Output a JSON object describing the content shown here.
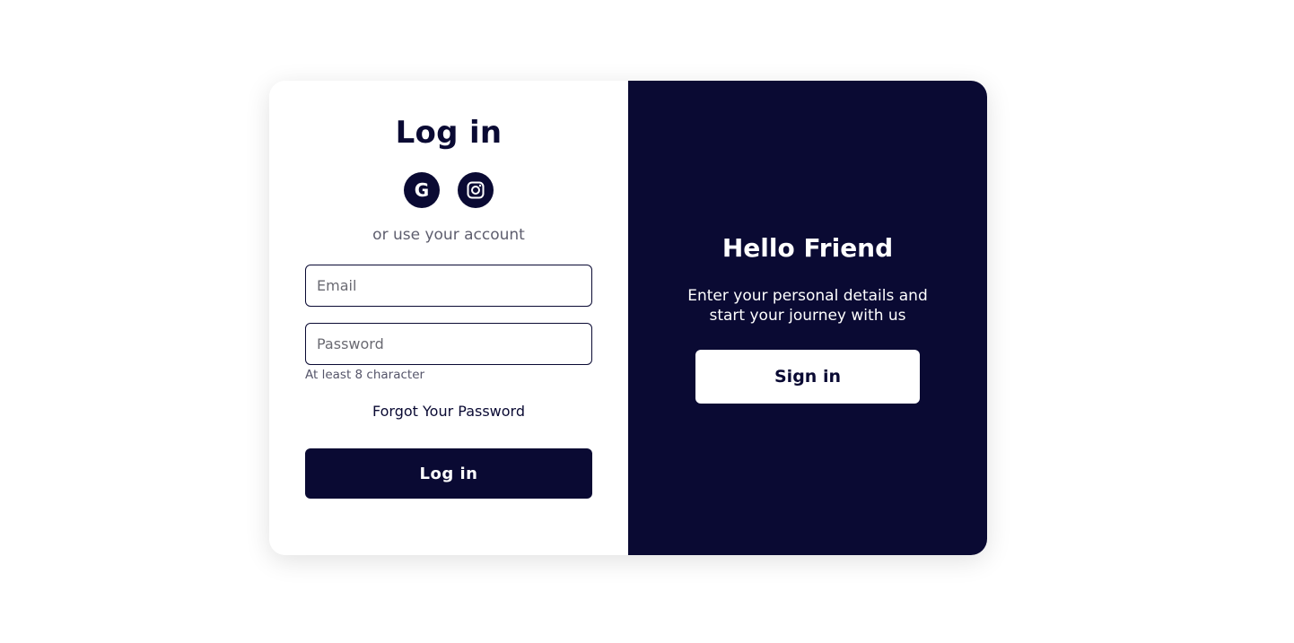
{
  "colors": {
    "primary": "#0a0a33",
    "background": "#ffffff",
    "muted_text": "#5e5e6e"
  },
  "login_panel": {
    "title": "Log in",
    "social_buttons": [
      {
        "icon": "google-icon",
        "glyph": "G"
      },
      {
        "icon": "instagram-icon"
      }
    ],
    "subtitle": "or use your account",
    "email": {
      "placeholder": "Email",
      "value": ""
    },
    "password": {
      "placeholder": "Password",
      "value": "",
      "hint": "At least 8 character"
    },
    "forgot_label": "Forgot Your Password",
    "submit_label": "Log in"
  },
  "welcome_panel": {
    "title": "Hello Friend",
    "description": "Enter your personal details and start your journey with us",
    "signin_label": "Sign in"
  }
}
